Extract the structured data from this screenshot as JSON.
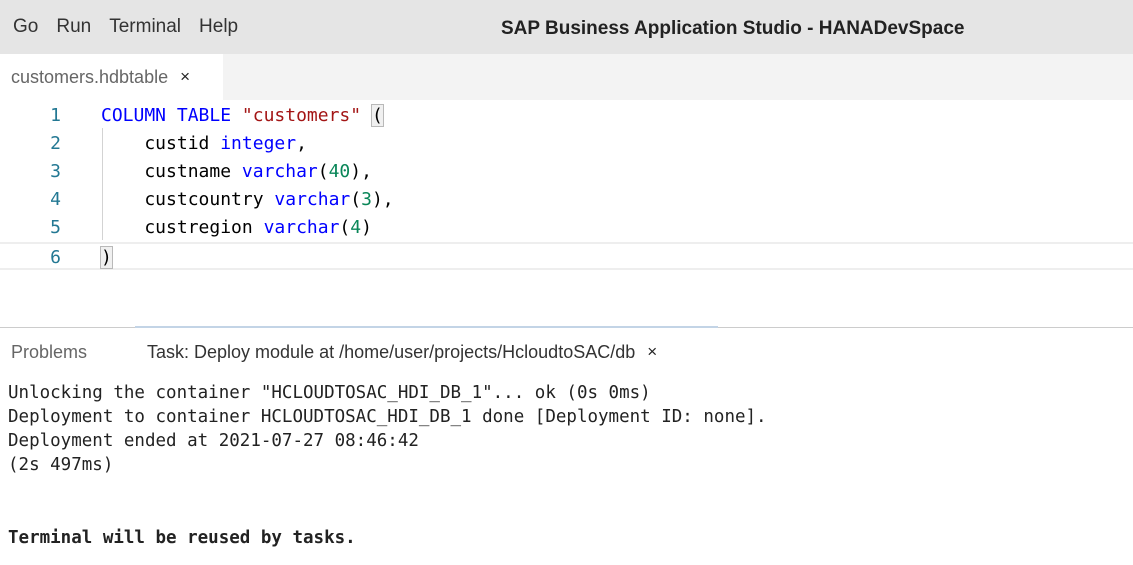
{
  "menu": {
    "items": [
      "Go",
      "Run",
      "Terminal",
      "Help"
    ]
  },
  "window": {
    "title": "SAP Business Application Studio - HANADevSpace"
  },
  "editor_tab": {
    "label": "customers.hdbtable",
    "close": "×"
  },
  "editor": {
    "line_numbers": [
      "1",
      "2",
      "3",
      "4",
      "5",
      "6"
    ],
    "lines": [
      [
        {
          "t": "COLUMN TABLE",
          "c": "keyword"
        },
        {
          "t": " ",
          "c": "plain"
        },
        {
          "t": "\"customers\"",
          "c": "string"
        },
        {
          "t": " ",
          "c": "plain"
        },
        {
          "t": "(",
          "c": "bracket"
        }
      ],
      [
        {
          "t": "    custid ",
          "c": "plain"
        },
        {
          "t": "integer",
          "c": "type"
        },
        {
          "t": ",",
          "c": "plain"
        }
      ],
      [
        {
          "t": "    custname ",
          "c": "plain"
        },
        {
          "t": "varchar",
          "c": "type"
        },
        {
          "t": "(",
          "c": "plain"
        },
        {
          "t": "40",
          "c": "number"
        },
        {
          "t": "),",
          "c": "plain"
        }
      ],
      [
        {
          "t": "    custcountry ",
          "c": "plain"
        },
        {
          "t": "varchar",
          "c": "type"
        },
        {
          "t": "(",
          "c": "plain"
        },
        {
          "t": "3",
          "c": "number"
        },
        {
          "t": "),",
          "c": "plain"
        }
      ],
      [
        {
          "t": "    custregion ",
          "c": "plain"
        },
        {
          "t": "varchar",
          "c": "type"
        },
        {
          "t": "(",
          "c": "plain"
        },
        {
          "t": "4",
          "c": "number"
        },
        {
          "t": ")",
          "c": "plain"
        }
      ],
      [
        {
          "t": ")",
          "c": "bracket"
        }
      ]
    ],
    "current_line": 6
  },
  "panel": {
    "problems_tab": "Problems",
    "task_tab": "Task: Deploy module at /home/user/projects/HcloudtoSAC/db",
    "task_close": "×"
  },
  "terminal": {
    "lines": [
      "Unlocking the container \"HCLOUDTOSAC_HDI_DB_1\"... ok (0s 0ms)",
      "Deployment to container HCLOUDTOSAC_HDI_DB_1 done [Deployment ID: none].",
      "Deployment ended at 2021-07-27 08:46:42",
      "(2s 497ms)"
    ],
    "footer": "Terminal will be reused by tasks."
  }
}
